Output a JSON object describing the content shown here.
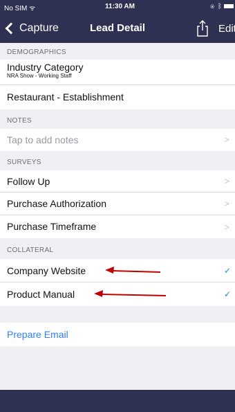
{
  "status_bar": {
    "carrier": "No SIM ᯤ",
    "time": "11:30 AM"
  },
  "nav": {
    "back_label": "Capture",
    "title": "Lead Detail",
    "edit_label": "Edit"
  },
  "sections": {
    "demographics": {
      "header": "DEMOGRAPHICS",
      "industry_title": "Industry Category",
      "industry_subtitle": "NRA Show - Working Staff",
      "industry_value": "Restaurant - Establishment"
    },
    "notes": {
      "header": "NOTES",
      "placeholder": "Tap to add notes"
    },
    "surveys": {
      "header": "SURVEYS",
      "items": [
        "Follow Up",
        "Purchase Authorization",
        "Purchase Timeframe"
      ]
    },
    "collateral": {
      "header": "COLLATERAL",
      "items": [
        "Company Website",
        "Product Manual"
      ]
    }
  },
  "actions": {
    "prepare_email": "Prepare Email"
  },
  "icons": {
    "chevron": "chevron-right-icon",
    "checkmark": "checkmark-icon",
    "share": "share-icon",
    "back": "chevron-left-icon"
  },
  "colors": {
    "nav": "#2f3152",
    "link": "#2f7ff6",
    "annotation_arrow": "#c00000",
    "background": "#efeff4"
  }
}
